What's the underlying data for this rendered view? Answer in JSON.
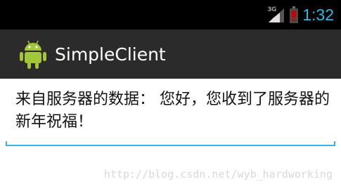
{
  "status_bar": {
    "network_type": "3G",
    "time": "1:32",
    "signal_icon": "signal-bars-icon",
    "battery_icon": "battery-low-icon"
  },
  "action_bar": {
    "app_icon": "android-robot-icon",
    "title": "SimpleClient"
  },
  "main": {
    "text_field_value": "来自服务器的数据： 您好，您收到了服务器的新年祝福！"
  },
  "watermark": "http://blog.csdn.net/wyb_hardworking",
  "colors": {
    "accent": "#33b5e5",
    "action_bar": "#2b2b2b",
    "status_bar": "#000000",
    "android_green": "#a4c639",
    "battery_alert": "#cc0000"
  }
}
